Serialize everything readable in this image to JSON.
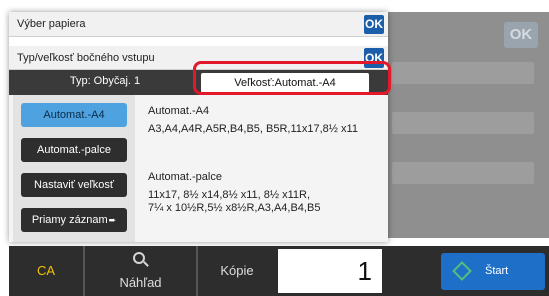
{
  "popup": {
    "title": "Výber papiera",
    "ok_label": "OK",
    "subtitle": "Typ/veľkosť bočného vstupu",
    "sub_ok_label": "OK",
    "tabs": {
      "type_label": "Typ:  Obyčaj. 1",
      "size_label": "Veľkosť:Automat.-A4"
    },
    "side_buttons": [
      {
        "label": "Automat.-A4",
        "active": true
      },
      {
        "label": "Automat.-palce",
        "active": false
      },
      {
        "label": "Nastaviť veľkosť",
        "active": false
      },
      {
        "label": "Priamy záznam",
        "active": false
      }
    ],
    "arrow_glyph": "➨",
    "info_a4": {
      "heading": "Automat.-A4",
      "sizes": "A3,A4,A4R,A5R,B4,B5, B5R,11x17,8½ x11"
    },
    "info_inch": {
      "heading": "Automat.-palce",
      "sizes_line1": "11x17, 8½ x14,8½ x11, 8½ x11R,",
      "sizes_line2": "7¼ x 10½R,5½ x8½R,A3,A4,B4,B5"
    }
  },
  "background": {
    "ok_label": "OK"
  },
  "bottom_bar": {
    "ca_label": "CA",
    "preview_label": "Náhľad",
    "copies_label": "Kópie",
    "copies_value": "1",
    "start_label": "Štart"
  },
  "colors": {
    "accent_blue": "#1b5faa",
    "active_button": "#4ea2e0",
    "highlight_red": "#e2192a",
    "ca_yellow": "#f2c200",
    "start_blue": "#1e6fc7"
  }
}
